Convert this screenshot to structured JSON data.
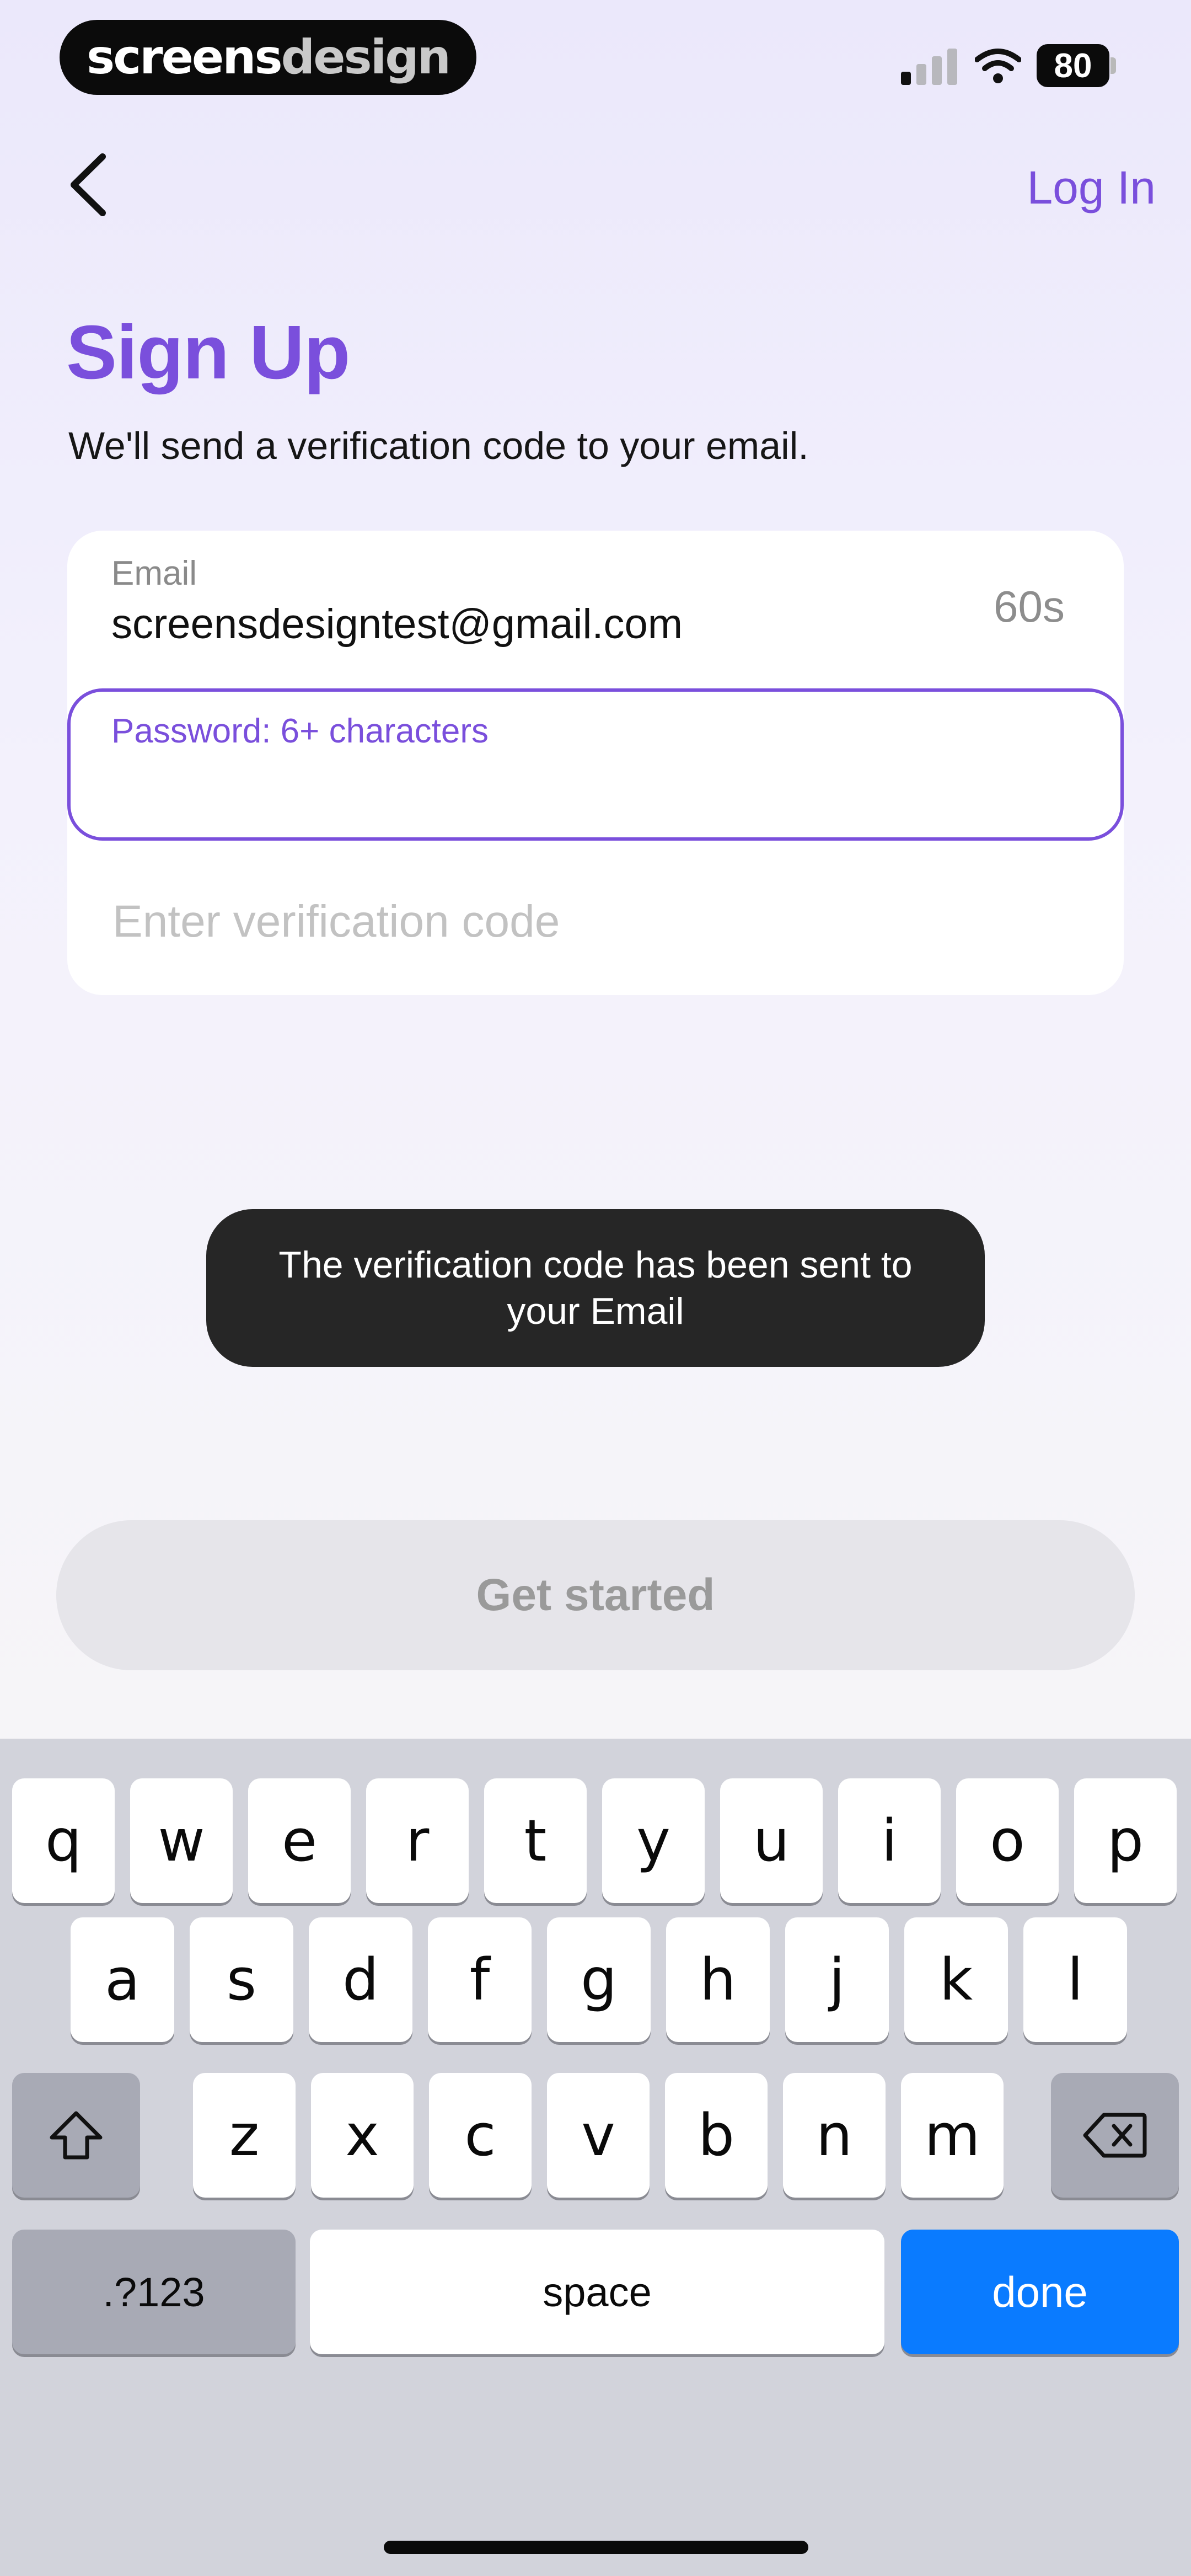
{
  "status_bar": {
    "brand_part1": "screens",
    "brand_part2": "design",
    "battery": "80",
    "signal_icon": "cellular-signal-icon",
    "wifi_icon": "wifi-icon"
  },
  "nav": {
    "back_icon": "chevron-left-icon",
    "login_label": "Log In"
  },
  "header": {
    "title": "Sign Up",
    "subtitle": "We'll send a verification code to your email."
  },
  "form": {
    "email_label": "Email",
    "email_value": "screensdesigntest@gmail.com",
    "timer": "60s",
    "password_label": "Password: 6+ characters",
    "password_value": "",
    "code_placeholder": "Enter verification code"
  },
  "toast": {
    "message": "The verification code has been sent to your Email"
  },
  "cta": {
    "label": "Get started"
  },
  "keyboard": {
    "row1": [
      "q",
      "w",
      "e",
      "r",
      "t",
      "y",
      "u",
      "i",
      "o",
      "p"
    ],
    "row2": [
      "a",
      "s",
      "d",
      "f",
      "g",
      "h",
      "j",
      "k",
      "l"
    ],
    "row3": [
      "z",
      "x",
      "c",
      "v",
      "b",
      "n",
      "m"
    ],
    "shift_icon": "shift-icon",
    "delete_icon": "backspace-icon",
    "numbers_label": ".?123",
    "space_label": "space",
    "done_label": "done"
  },
  "colors": {
    "accent": "#7a4fdc",
    "done_key": "#0a7bff",
    "toast_bg": "#262626"
  }
}
